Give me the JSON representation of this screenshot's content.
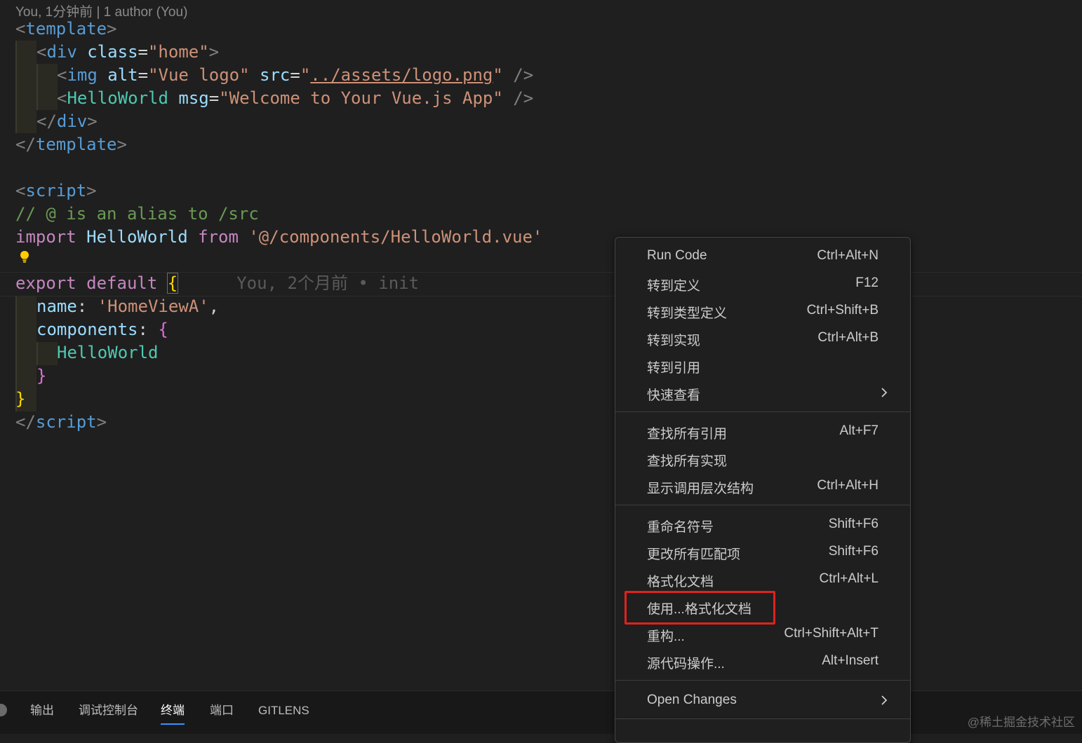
{
  "blame_header": "You, 1分钟前 | 1 author (You)",
  "code": {
    "l1": {
      "a": "<",
      "b": "template",
      "c": ">"
    },
    "l2": {
      "a": "<",
      "b": "div",
      "c": " ",
      "d": "class",
      "e": "=",
      "f": "\"home\"",
      "g": ">"
    },
    "l3": {
      "a": "<",
      "b": "img",
      "c": " ",
      "d": "alt",
      "e": "=",
      "f": "\"Vue logo\"",
      "g": " ",
      "h": "src",
      "i": "=",
      "j": "\"",
      "k": "../assets/logo.png",
      "l": "\"",
      "m": " />"
    },
    "l4": {
      "a": "<",
      "b": "HelloWorld",
      "c": " ",
      "d": "msg",
      "e": "=",
      "f": "\"Welcome to Your Vue.js App\"",
      "g": " />"
    },
    "l5": {
      "a": "</",
      "b": "div",
      "c": ">"
    },
    "l6": {
      "a": "</",
      "b": "template",
      "c": ">"
    },
    "l8": {
      "a": "<",
      "b": "script",
      "c": ">"
    },
    "l9": "// @ is an alias to /src",
    "l10": {
      "a": "import",
      "b": " HelloWorld ",
      "c": "from",
      "d": " ",
      "e": "'@/components/HelloWorld.vue'"
    },
    "l12": {
      "a": "export",
      "b": " ",
      "c": "default",
      "d": " ",
      "e": "{",
      "ghost": "You, 2个月前 • init"
    },
    "l13": {
      "a": "name",
      "b": ": ",
      "c": "'HomeViewA'",
      "d": ","
    },
    "l14": {
      "a": "components",
      "b": ": ",
      "c": "{"
    },
    "l15": "HelloWorld",
    "l16": "}",
    "l17": "}",
    "l18": {
      "a": "</",
      "b": "script",
      "c": ">"
    }
  },
  "panel": {
    "tabs": [
      "输出",
      "调试控制台",
      "终端",
      "端口",
      "GITLENS"
    ],
    "active_tab": "终端"
  },
  "watermark": "@稀土掘金技术社区",
  "context_menu": {
    "items": [
      {
        "label": "Run Code",
        "shortcut": "Ctrl+Alt+N"
      },
      {
        "label": "转到定义",
        "shortcut": "F12"
      },
      {
        "label": "转到类型定义",
        "shortcut": "Ctrl+Shift+B"
      },
      {
        "label": "转到实现",
        "shortcut": "Ctrl+Alt+B"
      },
      {
        "label": "转到引用",
        "shortcut": ""
      },
      {
        "label": "快速查看",
        "shortcut": "",
        "submenu": true
      },
      {
        "label": "查找所有引用",
        "shortcut": "Alt+F7"
      },
      {
        "label": "查找所有实现",
        "shortcut": ""
      },
      {
        "label": "显示调用层次结构",
        "shortcut": "Ctrl+Alt+H"
      },
      {
        "label": "重命名符号",
        "shortcut": "Shift+F6"
      },
      {
        "label": "更改所有匹配项",
        "shortcut": "Shift+F6"
      },
      {
        "label": "格式化文档",
        "shortcut": "Ctrl+Alt+L"
      },
      {
        "label": "使用...格式化文档",
        "shortcut": "",
        "highlighted": true
      },
      {
        "label": "重构...",
        "shortcut": "Ctrl+Shift+Alt+T"
      },
      {
        "label": "源代码操作...",
        "shortcut": "Alt+Insert"
      },
      {
        "label": "Open Changes",
        "shortcut": "",
        "submenu": true
      }
    ]
  },
  "colors": {
    "highlight_box": "#e0221e",
    "active_tab_underline": "#3794ff"
  }
}
